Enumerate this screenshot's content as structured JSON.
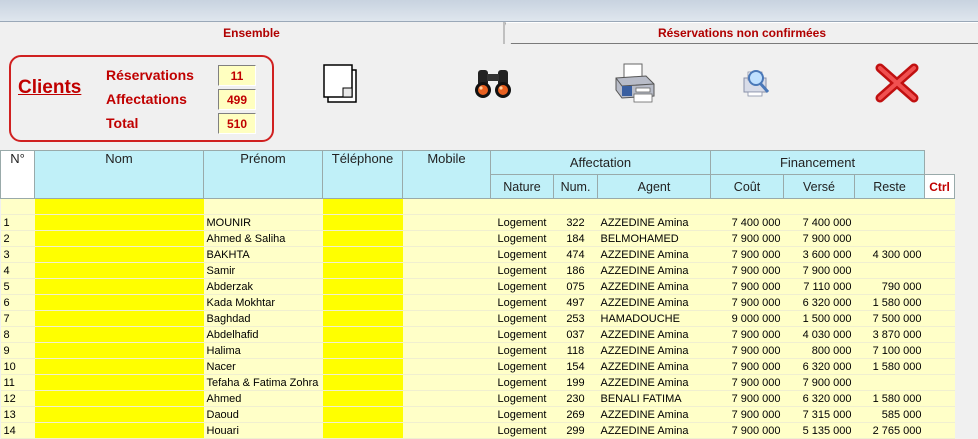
{
  "tabs": [
    {
      "label": "Ensemble"
    },
    {
      "label": "Réservations non confirmées"
    }
  ],
  "clients": {
    "title": "Clients",
    "rows": [
      {
        "label": "Réservations",
        "value": "11"
      },
      {
        "label": "Affectations",
        "value": "499"
      },
      {
        "label": "Total",
        "value": "510"
      }
    ]
  },
  "toolbar": {
    "icons": [
      "new-document-icon",
      "binoculars-icon",
      "printer-icon",
      "print-preview-icon",
      "close-icon"
    ]
  },
  "colors": {
    "accent_red": "#c00000",
    "header_cyan": "#c0f0f8",
    "row_bg": "#ffffc8",
    "highlight": "#ffff00"
  },
  "grid": {
    "headers": {
      "num": "N°",
      "nom": "Nom",
      "prenom": "Prénom",
      "telephone": "Téléphone",
      "mobile": "Mobile",
      "affectation": "Affectation",
      "financement": "Financement",
      "nature": "Nature",
      "numero": "Num.",
      "agent": "Agent",
      "cout": "Coût",
      "verse": "Versé",
      "reste": "Reste",
      "ctrl": "Ctrl"
    },
    "rows": [
      {
        "n": "1",
        "prenom": "MOUNIR",
        "nature": "Logement",
        "num": "322",
        "agent": "AZZEDINE Amina",
        "cout": "7 400 000",
        "verse": "7 400 000",
        "reste": ""
      },
      {
        "n": "2",
        "prenom": "Ahmed & Saliha",
        "nature": "Logement",
        "num": "184",
        "agent": "BELMOHAMED",
        "cout": "7 900 000",
        "verse": "7 900 000",
        "reste": ""
      },
      {
        "n": "3",
        "prenom": "BAKHTA",
        "nature": "Logement",
        "num": "474",
        "agent": "AZZEDINE Amina",
        "cout": "7 900 000",
        "verse": "3 600 000",
        "reste": "4 300 000"
      },
      {
        "n": "4",
        "prenom": "Samir",
        "nature": "Logement",
        "num": "186",
        "agent": "AZZEDINE Amina",
        "cout": "7 900 000",
        "verse": "7 900 000",
        "reste": ""
      },
      {
        "n": "5",
        "prenom": "Abderzak",
        "nature": "Logement",
        "num": "075",
        "agent": "AZZEDINE Amina",
        "cout": "7 900 000",
        "verse": "7 110 000",
        "reste": "790 000"
      },
      {
        "n": "6",
        "prenom": "Kada Mokhtar",
        "nature": "Logement",
        "num": "497",
        "agent": "AZZEDINE Amina",
        "cout": "7 900 000",
        "verse": "6 320 000",
        "reste": "1 580 000"
      },
      {
        "n": "7",
        "prenom": "Baghdad",
        "nature": "Logement",
        "num": "253",
        "agent": "HAMADOUCHE",
        "cout": "9 000 000",
        "verse": "1 500 000",
        "reste": "7 500 000"
      },
      {
        "n": "8",
        "prenom": "Abdelhafid",
        "nature": "Logement",
        "num": "037",
        "agent": "AZZEDINE Amina",
        "cout": "7 900 000",
        "verse": "4 030 000",
        "reste": "3 870 000"
      },
      {
        "n": "9",
        "prenom": "Halima",
        "nature": "Logement",
        "num": "118",
        "agent": "AZZEDINE Amina",
        "cout": "7 900 000",
        "verse": "800 000",
        "reste": "7 100 000"
      },
      {
        "n": "10",
        "prenom": "Nacer",
        "nature": "Logement",
        "num": "154",
        "agent": "AZZEDINE Amina",
        "cout": "7 900 000",
        "verse": "6 320 000",
        "reste": "1 580 000"
      },
      {
        "n": "11",
        "prenom": "Tefaha & Fatima Zohra",
        "nature": "Logement",
        "num": "199",
        "agent": "AZZEDINE Amina",
        "cout": "7 900 000",
        "verse": "7 900 000",
        "reste": ""
      },
      {
        "n": "12",
        "prenom": "Ahmed",
        "nature": "Logement",
        "num": "230",
        "agent": "BENALI FATIMA",
        "cout": "7 900 000",
        "verse": "6 320 000",
        "reste": "1 580 000"
      },
      {
        "n": "13",
        "prenom": "Daoud",
        "nature": "Logement",
        "num": "269",
        "agent": "AZZEDINE Amina",
        "cout": "7 900 000",
        "verse": "7 315 000",
        "reste": "585 000"
      },
      {
        "n": "14",
        "prenom": "Houari",
        "nature": "Logement",
        "num": "299",
        "agent": "AZZEDINE Amina",
        "cout": "7 900 000",
        "verse": "5 135 000",
        "reste": "2 765 000"
      }
    ]
  }
}
